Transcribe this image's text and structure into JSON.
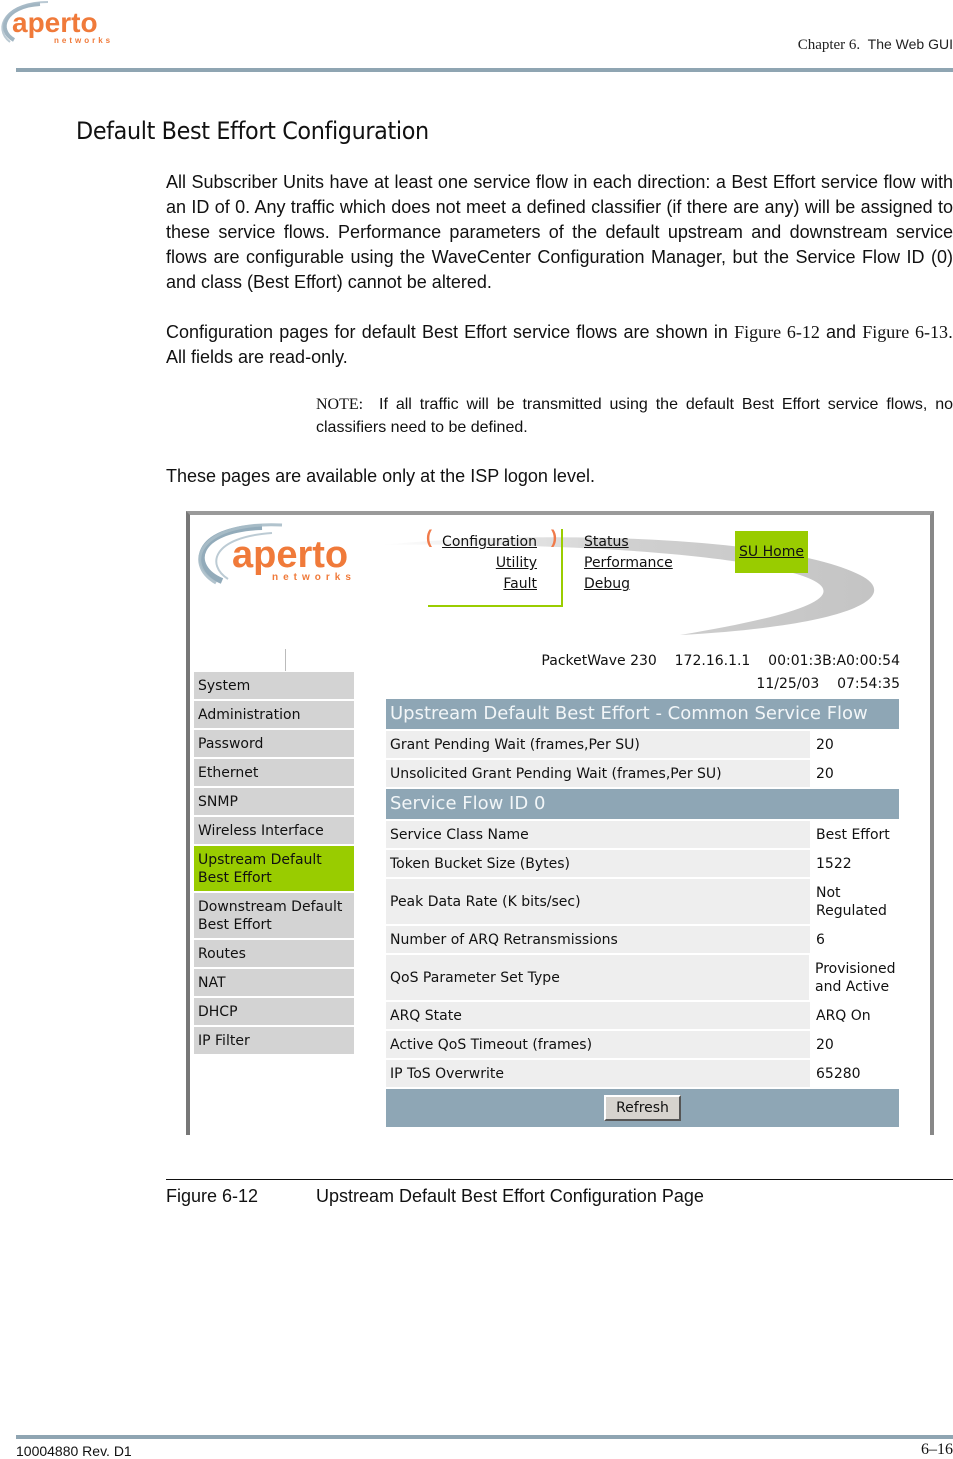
{
  "header": {
    "logo_text": "aperto",
    "logo_sub": "networks",
    "chapter_label": "Chapter 6.",
    "chapter_title": "The Web GUI"
  },
  "section_title": "Default Best Effort Configuration",
  "paragraphs": {
    "p1": "All Subscriber Units have at least one service flow in each direction: a Best Effort service flow with an ID of 0. Any traffic which does not meet a defined classifier (if there are any) will be assigned to these service flows. Performance parameters of the default upstream and downstream service flows are configurable using the WaveCenter Configuration Manager, but the Service Flow ID (0) and class (Best Effort) cannot be altered.",
    "p2_a": "Configuration pages for default Best Effort service flows are shown in ",
    "p2_fig1": "Figure 6-12",
    "p2_b": " and ",
    "p2_fig2": "Figure 6-13",
    "p2_c": ". All fields are read-only.",
    "note_label": "NOTE:",
    "note_text": "If all traffic will be transmitted using the default Best Effort service flows, no classifiers need to be defined.",
    "p3": "These pages are available only at the ISP logon level."
  },
  "screenshot": {
    "logo_text": "aperto",
    "logo_sub": "networks",
    "nav_left": [
      "Configuration",
      "Utility",
      "Fault"
    ],
    "nav_right": [
      "Status",
      "Performance",
      "Debug"
    ],
    "su_home": "SU Home",
    "device_info": {
      "model": "PacketWave 230",
      "ip": "172.16.1.1",
      "mac": "00:01:3B:A0:00:54",
      "date": "11/25/03",
      "time": "07:54:35"
    },
    "sidebar": [
      {
        "label": "System",
        "active": false
      },
      {
        "label": "Administration",
        "active": false
      },
      {
        "label": "Password",
        "active": false
      },
      {
        "label": "Ethernet",
        "active": false
      },
      {
        "label": "SNMP",
        "active": false
      },
      {
        "label": "Wireless Interface",
        "active": false
      },
      {
        "label": "Upstream Default Best Effort",
        "active": true
      },
      {
        "label": "Downstream Default Best Effort",
        "active": false
      },
      {
        "label": "Routes",
        "active": false
      },
      {
        "label": "NAT",
        "active": false
      },
      {
        "label": "DHCP",
        "active": false
      },
      {
        "label": "IP Filter",
        "active": false
      }
    ],
    "common_section": {
      "title": "Upstream Default Best Effort - Common Service Flow",
      "rows": [
        {
          "label": "Grant Pending Wait (frames,Per SU)",
          "value": "20"
        },
        {
          "label": "Unsolicited Grant Pending Wait (frames,Per SU)",
          "value": "20"
        }
      ]
    },
    "flow_section": {
      "title": "Service Flow ID 0",
      "rows": [
        {
          "label": "Service Class Name",
          "value": "Best Effort"
        },
        {
          "label": "Token Bucket Size (Bytes)",
          "value": "1522"
        },
        {
          "label": "Peak Data Rate (K bits/sec)",
          "value": "Not Regulated"
        },
        {
          "label": "Number of ARQ Retransmissions",
          "value": "6"
        },
        {
          "label": "QoS Parameter Set Type",
          "value": "Provisioned and Active"
        },
        {
          "label": "ARQ State",
          "value": "ARQ On"
        },
        {
          "label": "Active QoS Timeout (frames)",
          "value": "20"
        },
        {
          "label": "IP ToS Overwrite",
          "value": "65280"
        }
      ]
    },
    "refresh_label": "Refresh",
    "colors": {
      "accent_green": "#99cc00",
      "header_blue_gray": "#8ea6b5",
      "logo_orange": "#f07a3a"
    }
  },
  "caption": {
    "number": "Figure 6-12",
    "title": "Upstream Default Best Effort Configuration Page"
  },
  "footer": {
    "doc_id": "10004880 Rev. D1",
    "page": "6–16"
  }
}
